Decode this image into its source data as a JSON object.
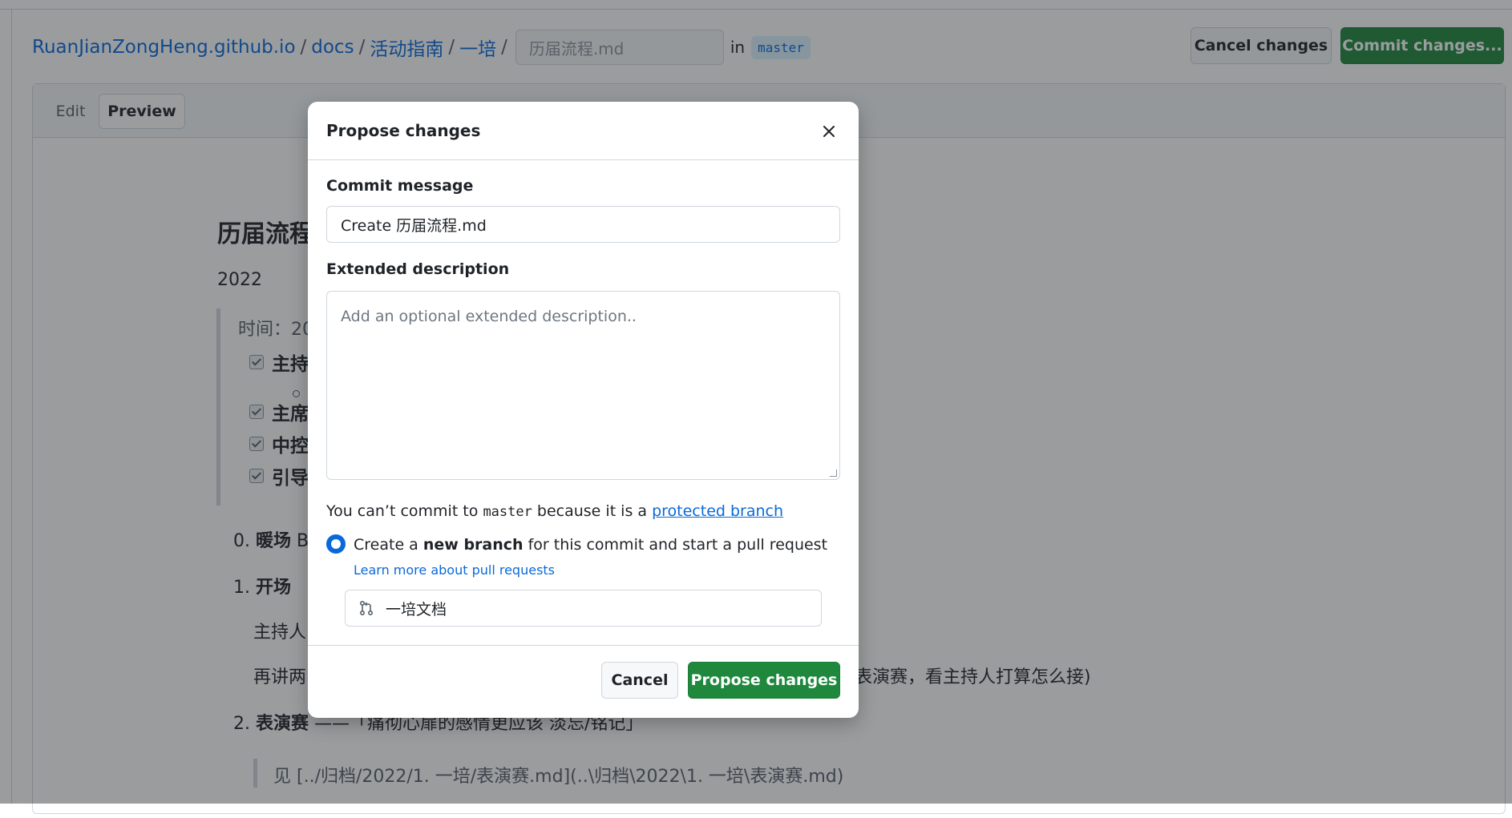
{
  "header": {
    "breadcrumb": {
      "repo": "RuanJianZongHeng.github.io",
      "sep": "/",
      "path": [
        "docs",
        "活动指南",
        "一培"
      ]
    },
    "filename": "历届流程.md",
    "in_text": "in",
    "branch": "master",
    "cancel_label": "Cancel changes",
    "commit_label": "Commit changes..."
  },
  "editor": {
    "tabs": [
      "Edit",
      "Preview"
    ],
    "active_tab": "Preview"
  },
  "preview": {
    "title_partial": "历届流程",
    "year": "2022",
    "time_label": "时间：20",
    "checklist": [
      "主持",
      "主席",
      "中控",
      "引导"
    ],
    "items": {
      "warmup_num": "0.",
      "warmup": "暖场",
      "warmup_tail": "B",
      "opening_num": "1.",
      "opening": "开场",
      "host_line": "主持人",
      "again_line_start": "再讲两",
      "again_line_end": "表演赛，看主持人打算怎么接)",
      "show_num": "2.",
      "show": "表演赛",
      "show_tail": "——「痛彻心扉的感情更应该 淡忘/铭记」",
      "see_line": "见 [../归档/2022/1. 一培/表演赛.md](..\\归档\\2022\\1. 一培\\表演赛.md)"
    }
  },
  "dialog": {
    "title": "Propose changes",
    "close_icon": "close-icon",
    "commit_message_label": "Commit message",
    "commit_message_value": "Create 历届流程.md",
    "extended_label": "Extended description",
    "extended_placeholder": "Add an optional extended description..",
    "protected_prefix": "You can’t commit to",
    "protected_branch_code": "master",
    "protected_middle": "because it is a",
    "protected_link": "protected branch",
    "radio_prefix": "Create a",
    "radio_bold": "new branch",
    "radio_suffix": "for this commit and start a pull request",
    "learn_more": "Learn more about pull requests",
    "new_branch_name": "一培文档",
    "cancel_label": "Cancel",
    "propose_label": "Propose changes"
  },
  "colors": {
    "accent": "#0969da",
    "primary_button": "#1f883d"
  }
}
